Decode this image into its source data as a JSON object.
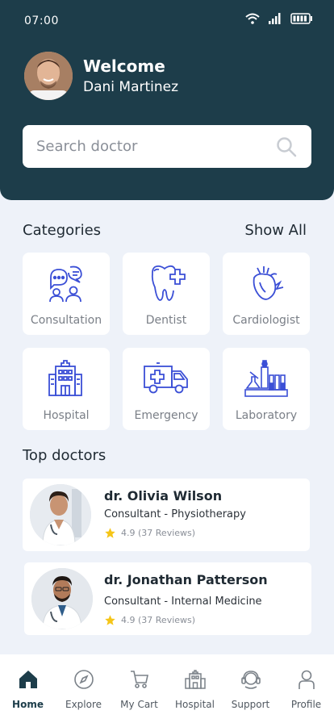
{
  "status": {
    "time": "07:00"
  },
  "header": {
    "welcome": "Welcome",
    "username": "Dani Martinez",
    "search_placeholder": "Search doctor"
  },
  "categories": {
    "title": "Categories",
    "show_all": "Show All",
    "items": [
      {
        "label": "Consultation",
        "icon": "chat-people-icon"
      },
      {
        "label": "Dentist",
        "icon": "tooth-icon"
      },
      {
        "label": "Cardiologist",
        "icon": "heart-icon"
      },
      {
        "label": "Hospital",
        "icon": "hospital-building-icon"
      },
      {
        "label": "Emergency",
        "icon": "ambulance-icon"
      },
      {
        "label": "Laboratory",
        "icon": "lab-icon"
      }
    ]
  },
  "top_doctors": {
    "title": "Top doctors",
    "items": [
      {
        "name": "dr. Olivia Wilson",
        "role": "Consultant - Physiotherapy",
        "rating": "4.9 (37 Reviews)"
      },
      {
        "name": "dr. Jonathan Patterson",
        "role": "Consultant - Internal Medicine",
        "rating": "4.9 (37 Reviews)"
      }
    ]
  },
  "nav": {
    "items": [
      {
        "label": "Home",
        "icon": "home-icon",
        "active": true
      },
      {
        "label": "Explore",
        "icon": "compass-icon",
        "active": false
      },
      {
        "label": "My Cart",
        "icon": "cart-icon",
        "active": false
      },
      {
        "label": "Hospital",
        "icon": "hospital-icon",
        "active": false
      },
      {
        "label": "Support",
        "icon": "headset-icon",
        "active": false
      },
      {
        "label": "Profile",
        "icon": "user-icon",
        "active": false
      }
    ]
  },
  "colors": {
    "header_bg": "#1d3d4a",
    "accent": "#3b4fd6",
    "star": "#f5c518"
  }
}
